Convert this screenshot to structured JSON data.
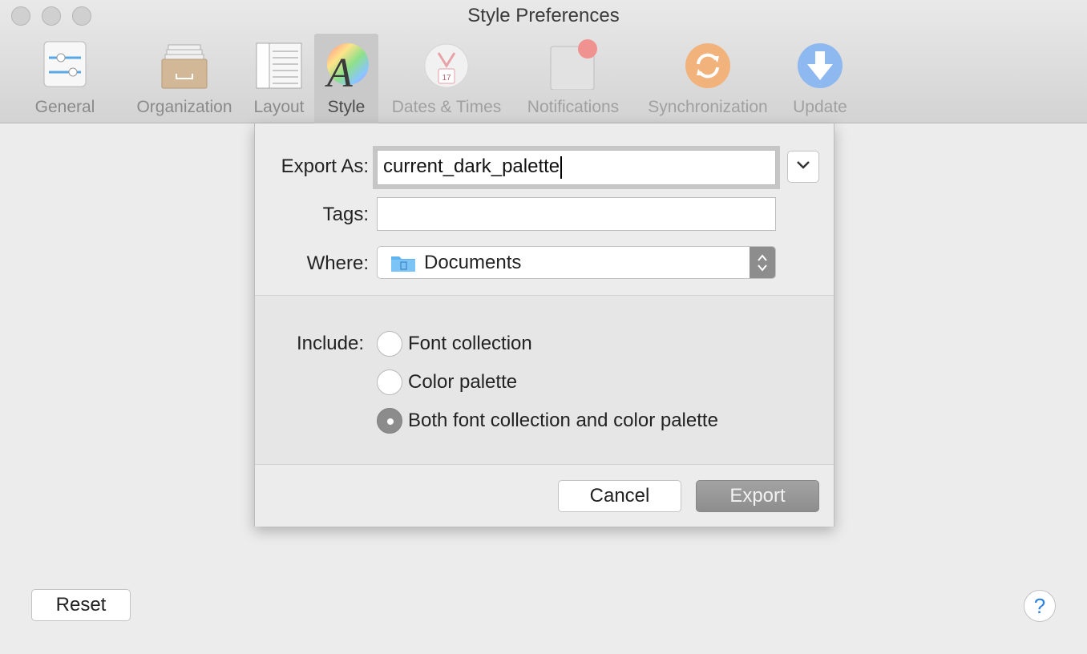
{
  "window": {
    "title": "Style Preferences"
  },
  "toolbar": {
    "items": [
      {
        "label": "General",
        "icon": "sliders-icon",
        "selected": false
      },
      {
        "label": "Organization",
        "icon": "drawer-icon",
        "selected": false
      },
      {
        "label": "Layout",
        "icon": "layout-icon",
        "selected": false
      },
      {
        "label": "Style",
        "icon": "color-wheel-icon",
        "selected": true
      },
      {
        "label": "Dates & Times",
        "icon": "calendar-icon",
        "selected": false
      },
      {
        "label": "Notifications",
        "icon": "notification-badge-icon",
        "selected": false
      },
      {
        "label": "Synchronization",
        "icon": "sync-icon",
        "selected": false
      },
      {
        "label": "Update",
        "icon": "download-arrow-icon",
        "selected": false
      }
    ],
    "calendar_day": "17"
  },
  "export_sheet": {
    "export_as_label": "Export As:",
    "export_as_value": "current_dark_palette",
    "tags_label": "Tags:",
    "tags_value": "",
    "where_label": "Where:",
    "where_value": "Documents",
    "include_label": "Include:",
    "include_options": [
      {
        "label": "Font collection",
        "checked": false
      },
      {
        "label": "Color palette",
        "checked": false
      },
      {
        "label": "Both font collection and color palette",
        "checked": true
      }
    ],
    "cancel_label": "Cancel",
    "export_label": "Export"
  },
  "footer": {
    "reset_label": "Reset",
    "help_label": "?"
  },
  "colors": {
    "accent_blue": "#2d7fe0",
    "folder_blue": "#5fb4ef",
    "selected_tab_bg": "#c9c9c9"
  }
}
